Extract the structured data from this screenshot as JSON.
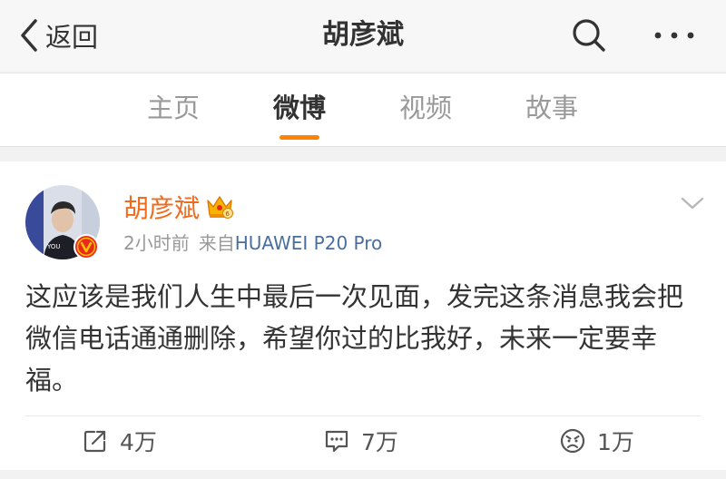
{
  "header": {
    "back_label": "返回",
    "title": "胡彦斌",
    "icons": {
      "back": "chevron-left-icon",
      "search": "search-icon",
      "more": "more-dots-icon"
    }
  },
  "tabs": [
    {
      "label": "主页",
      "active": false
    },
    {
      "label": "微博",
      "active": true
    },
    {
      "label": "视频",
      "active": false
    },
    {
      "label": "故事",
      "active": false
    }
  ],
  "post": {
    "author": "胡彦斌",
    "time": "2小时前",
    "source_prefix": "来自",
    "device": "HUAWEI P20 Pro",
    "text": "这应该是我们人生中最后一次见面，发完这条消息我会把微信电话通通删除，希望你过的比我好，未来一定要幸福。",
    "actions": {
      "repost": "4万",
      "comment": "7万",
      "like": "1万"
    }
  },
  "colors": {
    "accent": "#ff8200",
    "author_name": "#f26b1d",
    "link": "#4a6e9e",
    "verified_badge": "#e8291c",
    "crown": "#f5b400"
  }
}
